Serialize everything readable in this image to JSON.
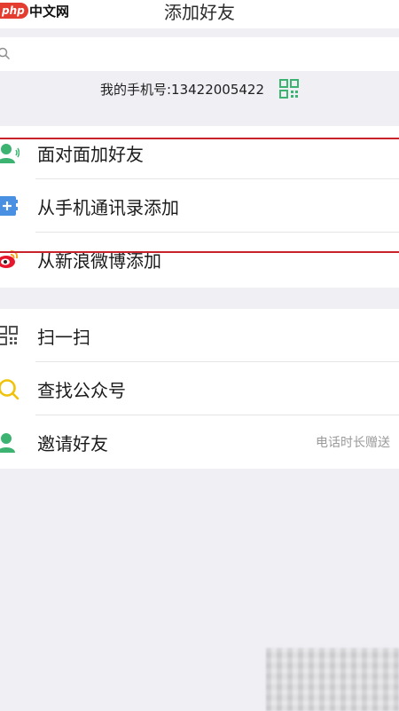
{
  "watermark": {
    "badge": "php",
    "site": "中文网"
  },
  "header": {
    "title": "添加好友"
  },
  "search": {
    "icon": "search-icon"
  },
  "phone": {
    "text": "我的手机号:13422005422",
    "icon": "qr-code-icon"
  },
  "section1": {
    "items": [
      {
        "label": "面对面加好友",
        "icon": "face-to-face-icon",
        "color": "#3cb371"
      },
      {
        "label": "从手机通讯录添加",
        "icon": "contacts-book-icon",
        "color": "#4a90e2"
      },
      {
        "label": "从新浪微博添加",
        "icon": "weibo-icon",
        "color": "#e6162d"
      }
    ]
  },
  "section2": {
    "items": [
      {
        "label": "扫一扫",
        "icon": "scan-icon",
        "color": "#555555"
      },
      {
        "label": "查找公众号",
        "icon": "search-official-icon",
        "color": "#f0c20a"
      },
      {
        "label": "邀请好友",
        "icon": "invite-friend-icon",
        "color": "#3cb371",
        "hint": "电话时长赠送"
      }
    ]
  },
  "colors": {
    "background": "#efeff4",
    "annotation": "#c8232c"
  }
}
